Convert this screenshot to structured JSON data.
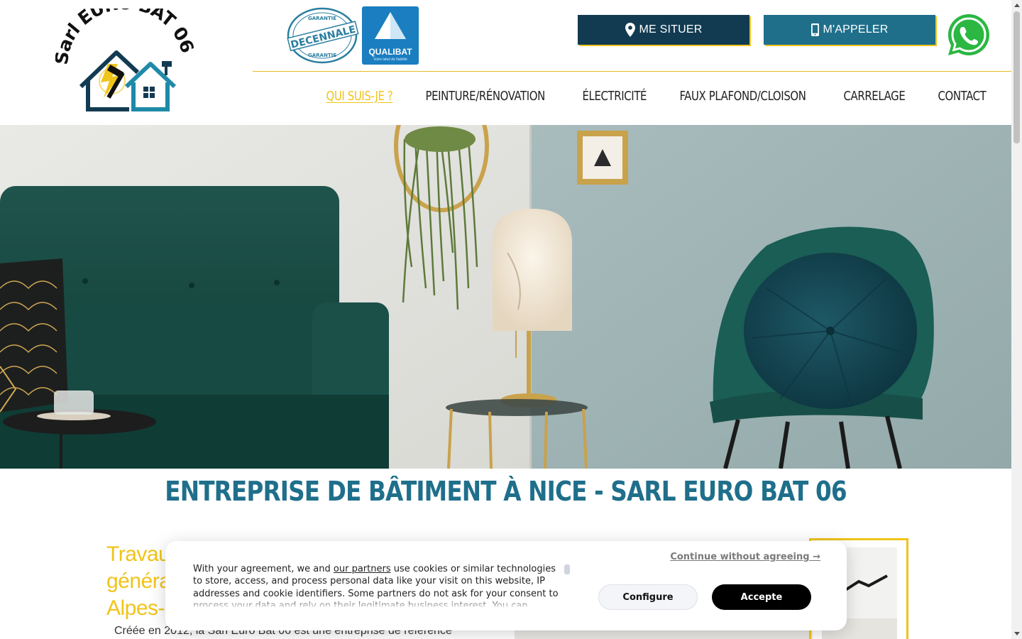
{
  "brand": {
    "logo_text": "Sarl EURO BAT 06",
    "badge_garantie_top": "GARANTIE",
    "badge_garantie_main": "DECENNALE",
    "badge_qualibat": "QUALIBAT",
    "badge_qualibat_sub": "Votre label de fiabilité",
    "accent_color": "#f0c419",
    "primary_color": "#1f6f8b",
    "dark_color": "#123b52"
  },
  "header": {
    "situer_label": "ME SITUER",
    "appeler_label": "M'APPELER",
    "whatsapp_icon": "whatsapp-icon"
  },
  "nav": {
    "items": [
      {
        "label": "QUI SUIS-JE ?",
        "active": true
      },
      {
        "label": "PEINTURE/RÉNOVATION"
      },
      {
        "label": "ÉLECTRICITÉ"
      },
      {
        "label": "FAUX PLAFOND/CLOISON"
      },
      {
        "label": "CARRELAGE"
      },
      {
        "label": "CONTACT"
      }
    ]
  },
  "main": {
    "title": "ENTREPRISE DE BÂTIMENT À NICE - SARL EURO BAT 06",
    "heading_lines": [
      "Travau",
      "généra",
      "Alpes-"
    ],
    "intro": "Créée en 2012, la Sarl Euro Bat 06 est une entreprise de référence"
  },
  "cookie": {
    "text_before": "With your agreement, we and ",
    "partners_link": "our partners",
    "text_after": " use cookies or similar technologies to store, access, and process personal data like your visit on this website, IP addresses and cookie identifiers. Some partners do not ask for your consent to process your data and rely on their legitimate business interest. You can",
    "continue_label": "Continue without agreeing →",
    "configure_label": "Configure",
    "accept_label": "Accepte"
  }
}
